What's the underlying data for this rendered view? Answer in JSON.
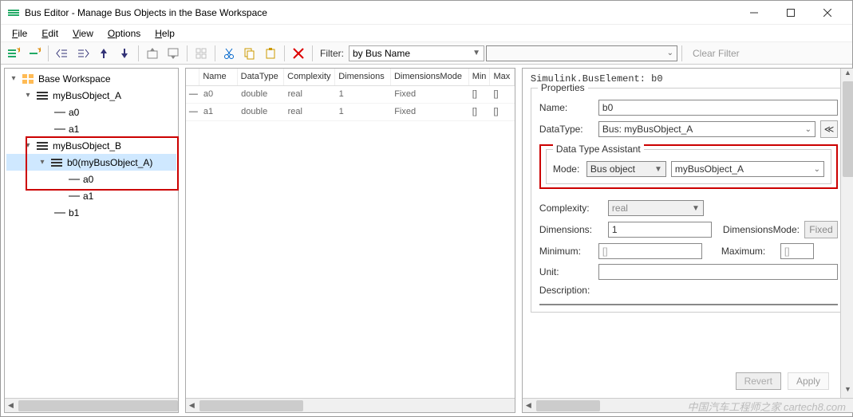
{
  "window": {
    "title": "Bus Editor - Manage Bus Objects in the Base Workspace"
  },
  "menu": {
    "file": "File",
    "edit": "Edit",
    "view": "View",
    "options": "Options",
    "help": "Help"
  },
  "filter": {
    "label": "Filter:",
    "by": "by Bus Name",
    "value": "",
    "clear": "Clear Filter"
  },
  "tree": {
    "root": "Base Workspace",
    "a": {
      "name": "myBusObject_A",
      "c0": "a0",
      "c1": "a1"
    },
    "b": {
      "name": "myBusObject_B",
      "b0": "b0(myBusObject_A)",
      "b0c0": "a0",
      "b0c1": "a1",
      "b1": "b1"
    }
  },
  "gridh": {
    "name": "Name",
    "dt": "DataType",
    "cx": "Complexity",
    "dim": "Dimensions",
    "dm": "DimensionsMode",
    "min": "Min",
    "max": "Max"
  },
  "gridr": [
    {
      "name": "a0",
      "dt": "double",
      "cx": "real",
      "dim": "1",
      "dm": "Fixed",
      "min": "[]",
      "max": "[]"
    },
    {
      "name": "a1",
      "dt": "double",
      "cx": "real",
      "dim": "1",
      "dm": "Fixed",
      "min": "[]",
      "max": "[]"
    }
  ],
  "props": {
    "header": "Simulink.BusElement: b0",
    "legend": "Properties",
    "name_l": "Name:",
    "name_v": "b0",
    "dt_l": "DataType:",
    "dt_v": "Bus: myBusObject_A",
    "dta_legend": "Data Type Assistant",
    "mode_l": "Mode:",
    "mode_v": "Bus object",
    "mode_obj": "myBusObject_A",
    "cx_l": "Complexity:",
    "cx_v": "real",
    "dim_l": "Dimensions:",
    "dim_v": "1",
    "dm_l": "DimensionsMode:",
    "dm_v": "Fixed",
    "min_l": "Minimum:",
    "min_v": "[]",
    "max_l": "Maximum:",
    "max_v": "[]",
    "unit_l": "Unit:",
    "unit_v": "",
    "desc_l": "Description:",
    "desc_v": "",
    "revert": "Revert",
    "apply": "Apply"
  },
  "watermark": "中国汽车工程师之家 cartech8.com"
}
